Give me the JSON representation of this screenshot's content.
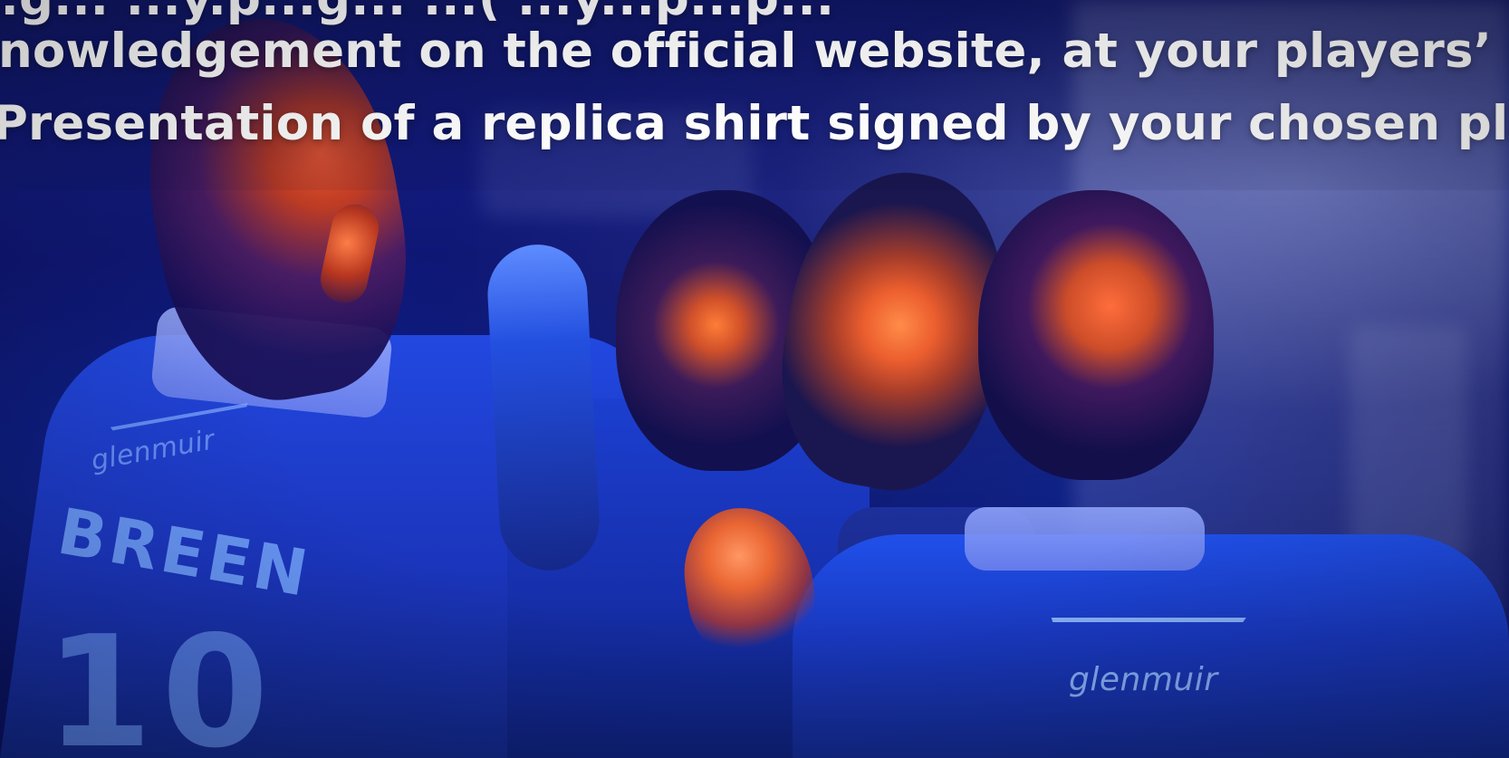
{
  "hero": {
    "lines": [
      "...g...                                            ...y.p...g...         ...(        ...y...p...p...",
      "nowledgement on the official website, at your players’ profi",
      "Presentation of a replica shirt signed by your chosen player."
    ],
    "photo_text": {
      "left_logo": "glenmuir",
      "player_name": "BREEN",
      "player_number": "10",
      "right_logo": "glenmuir"
    }
  }
}
